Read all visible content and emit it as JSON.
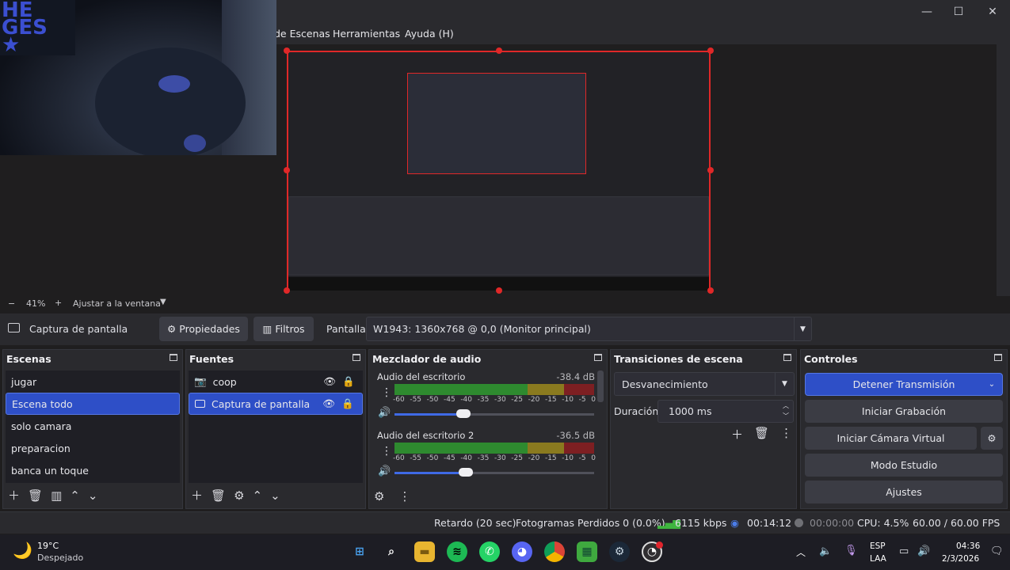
{
  "menu": {
    "escenas": "de Escenas",
    "herramientas": "Herramientas",
    "ayuda": "Ayuda (H)"
  },
  "window": {
    "minimize": "—",
    "maximize": "☐",
    "close": "✕"
  },
  "webcam_text": "HE\nGES\n★",
  "zoombar": {
    "minus": "−",
    "zoom": "41%",
    "plus": "+",
    "fit": "Ajustar a la ventana"
  },
  "source_toolbar": {
    "source_name": "Captura de pantalla",
    "properties": "Propiedades",
    "filters": "Filtros",
    "pantalla_label": "Pantalla",
    "pantalla_value": "W1943: 1360x768 @ 0,0 (Monitor principal)"
  },
  "scenes": {
    "title": "Escenas",
    "items": [
      "jugar",
      "Escena todo",
      "solo camara",
      "preparacion",
      "banca un toque"
    ],
    "selected": 1
  },
  "sources": {
    "title": "Fuentes",
    "items": [
      "coop",
      "Captura de pantalla"
    ],
    "selected": 1
  },
  "mixer": {
    "title": "Mezclador de audio",
    "channels": [
      {
        "name": "Audio del escritorio",
        "db": "-38.4 dB",
        "volume": 0.31
      },
      {
        "name": "Audio del escritorio 2",
        "db": "-36.5 dB",
        "volume": 0.32
      }
    ],
    "ticks": [
      "-60",
      "-55",
      "-50",
      "-45",
      "-40",
      "-35",
      "-30",
      "-25",
      "-20",
      "-15",
      "-10",
      "-5",
      "0"
    ]
  },
  "transitions": {
    "title": "Transiciones de escena",
    "type": "Desvanecimiento",
    "duration_label": "Duración",
    "duration_value": "1000 ms"
  },
  "controls": {
    "title": "Controles",
    "stop_stream": "Detener Transmisión",
    "start_recording": "Iniciar Grabación",
    "start_vcam": "Iniciar Cámara Virtual",
    "studio_mode": "Modo Estudio",
    "settings": "Ajustes"
  },
  "status": {
    "delay": "Retardo (20 sec)",
    "dropped": "Fotogramas Perdidos 0 (0.0%)",
    "bitrate": "6115 kbps",
    "stream_time": "00:14:12",
    "rec_time": "00:00:00",
    "cpu": "CPU: 4.5%",
    "fps": "60.00 / 60.00 FPS"
  },
  "taskbar": {
    "weather_temp": "19°C",
    "weather_desc": "Despejado",
    "lang1": "ESP",
    "lang2": "LAA",
    "time": "04:36",
    "date": "2/3/2026"
  },
  "colors": {
    "accent": "#2e4fc7",
    "selection_border": "#e02828",
    "meter_green": "#2e8a2f",
    "meter_yellow": "#8a7a1f",
    "meter_red": "#7d1f22"
  }
}
